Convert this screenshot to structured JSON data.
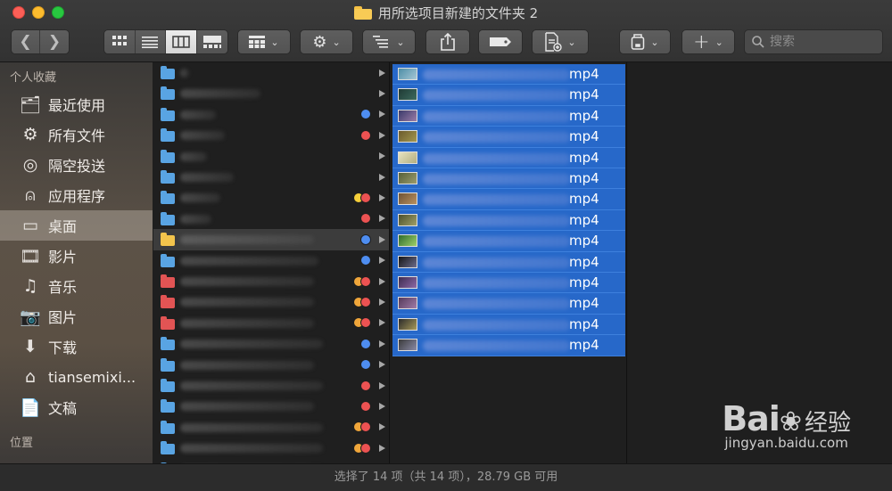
{
  "window": {
    "title": "用所选项目新建的文件夹 2"
  },
  "toolbar": {
    "back_icon": "chevron-left-icon",
    "forward_icon": "chevron-right-icon",
    "view_modes": [
      "icon-view",
      "list-view",
      "column-view",
      "gallery-view"
    ],
    "active_view": "column-view",
    "search_placeholder": "搜索"
  },
  "sidebar": {
    "favorites_header": "个人收藏",
    "items": [
      {
        "label": "最近使用",
        "icon": "recents-icon",
        "glyph": "🗂"
      },
      {
        "label": "所有文件",
        "icon": "gear-icon",
        "glyph": "⚙"
      },
      {
        "label": "隔空投送",
        "icon": "airdrop-icon",
        "glyph": "◎"
      },
      {
        "label": "应用程序",
        "icon": "applications-icon",
        "glyph": "⍝"
      },
      {
        "label": "桌面",
        "icon": "desktop-icon",
        "glyph": "▭",
        "selected": true
      },
      {
        "label": "影片",
        "icon": "movies-icon",
        "glyph": "🎞"
      },
      {
        "label": "音乐",
        "icon": "music-icon",
        "glyph": "♫"
      },
      {
        "label": "图片",
        "icon": "camera-icon",
        "glyph": "📷"
      },
      {
        "label": "下载",
        "icon": "download-icon",
        "glyph": "⬇"
      },
      {
        "label": "tiansemixi...",
        "icon": "home-icon",
        "glyph": "⌂"
      },
      {
        "label": "文稿",
        "icon": "documents-icon",
        "glyph": "📄"
      }
    ],
    "locations_header": "位置"
  },
  "column1": {
    "rows": [
      {
        "folder": "blue",
        "tags": [],
        "w": 0
      },
      {
        "folder": "blue",
        "tags": [],
        "w": 1
      },
      {
        "folder": "blue",
        "tags": [
          "blue"
        ],
        "w": 2
      },
      {
        "folder": "blue",
        "tags": [
          "red"
        ],
        "w": 3
      },
      {
        "folder": "blue",
        "tags": [],
        "w": 4
      },
      {
        "folder": "blue",
        "tags": [],
        "w": 5
      },
      {
        "folder": "blue",
        "tags": [
          "yellow",
          "red"
        ],
        "w": 6
      },
      {
        "folder": "blue",
        "tags": [
          "red"
        ],
        "w": 7
      },
      {
        "folder": "yellow",
        "tags": [
          "blue"
        ],
        "w": 8,
        "highlight": true
      },
      {
        "folder": "blue",
        "tags": [
          "blue"
        ],
        "w": 9
      },
      {
        "folder": "red",
        "tags": [
          "orange",
          "red"
        ],
        "w": 10
      },
      {
        "folder": "red",
        "tags": [
          "orange",
          "red"
        ],
        "w": 11
      },
      {
        "folder": "red",
        "tags": [
          "orange",
          "red"
        ],
        "w": 12
      },
      {
        "folder": "blue",
        "tags": [
          "blue"
        ],
        "w": 13
      },
      {
        "folder": "blue",
        "tags": [
          "blue"
        ],
        "w": 14
      },
      {
        "folder": "blue",
        "tags": [
          "red"
        ],
        "w": 15
      },
      {
        "folder": "blue",
        "tags": [
          "red"
        ],
        "w": 16
      },
      {
        "folder": "blue",
        "tags": [
          "orange",
          "red"
        ],
        "w": 17
      },
      {
        "folder": "blue",
        "tags": [
          "orange",
          "red"
        ],
        "w": 18
      },
      {
        "folder": "blue",
        "tags": [
          "yellow"
        ],
        "w": 19
      }
    ]
  },
  "column2": {
    "files": [
      {
        "ext": "mp4"
      },
      {
        "ext": "mp4"
      },
      {
        "ext": "mp4"
      },
      {
        "ext": "mp4"
      },
      {
        "ext": "mp4"
      },
      {
        "ext": "mp4"
      },
      {
        "ext": "mp4"
      },
      {
        "ext": "mp4"
      },
      {
        "ext": "mp4"
      },
      {
        "ext": "mp4"
      },
      {
        "ext": "mp4"
      },
      {
        "ext": "mp4"
      },
      {
        "ext": "mp4"
      },
      {
        "ext": "mp4"
      }
    ]
  },
  "status": {
    "text": "选择了 14 项（共 14 项），28.79 GB 可用"
  },
  "watermark": {
    "logo": "Bai",
    "logo_suffix": "经验",
    "url": "jingyan.baidu.com"
  },
  "colors": {
    "selection_blue": "#2768c9",
    "tag_blue": "#4e8df0",
    "tag_red": "#ec5252",
    "tag_orange": "#f0a63a",
    "tag_yellow": "#f6cf3a",
    "folder_blue": "#59a4e3"
  }
}
